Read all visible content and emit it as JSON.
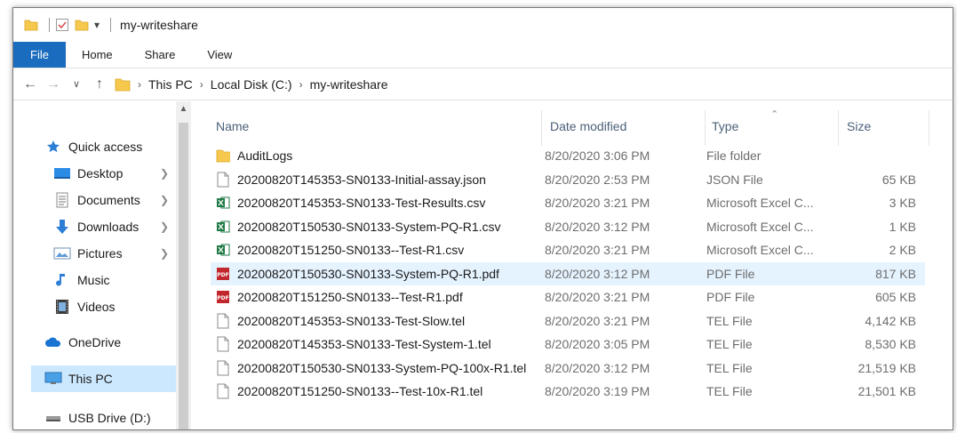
{
  "window": {
    "title": "my-writeshare"
  },
  "ribbon": {
    "tabs": [
      "File",
      "Home",
      "Share",
      "View"
    ]
  },
  "address": {
    "crumbs": [
      "This PC",
      "Local Disk (C:)",
      "my-writeshare"
    ]
  },
  "nav": {
    "items": [
      {
        "label": "Quick access",
        "icon": "star-icon"
      },
      {
        "label": "Desktop",
        "icon": "desktop-icon"
      },
      {
        "label": "Documents",
        "icon": "documents-icon"
      },
      {
        "label": "Downloads",
        "icon": "download-arrow-icon"
      },
      {
        "label": "Pictures",
        "icon": "pictures-icon"
      },
      {
        "label": "Music",
        "icon": "music-note-icon"
      },
      {
        "label": "Videos",
        "icon": "video-film-icon"
      },
      {
        "label": "OneDrive",
        "icon": "cloud-icon"
      },
      {
        "label": "This PC",
        "icon": "monitor-icon"
      },
      {
        "label": "USB Drive (D:)",
        "icon": "usb-drive-icon"
      }
    ]
  },
  "columns": {
    "name": "Name",
    "date": "Date modified",
    "type": "Type",
    "size": "Size"
  },
  "files": [
    {
      "name": "AuditLogs",
      "date": "8/20/2020 3:06 PM",
      "type": "File folder",
      "size": "",
      "icon": "folder-icon"
    },
    {
      "name": "20200820T145353-SN0133-Initial-assay.json",
      "date": "8/20/2020 2:53 PM",
      "type": "JSON File",
      "size": "65 KB",
      "icon": "generic-file-icon"
    },
    {
      "name": "20200820T145353-SN0133-Test-Results.csv",
      "date": "8/20/2020 3:21 PM",
      "type": "Microsoft Excel C...",
      "size": "3 KB",
      "icon": "excel-file-icon"
    },
    {
      "name": "20200820T150530-SN0133-System-PQ-R1.csv",
      "date": "8/20/2020 3:12 PM",
      "type": "Microsoft Excel C...",
      "size": "1 KB",
      "icon": "excel-file-icon"
    },
    {
      "name": "20200820T151250-SN0133--Test-R1.csv",
      "date": "8/20/2020 3:21 PM",
      "type": "Microsoft Excel C...",
      "size": "2 KB",
      "icon": "excel-file-icon"
    },
    {
      "name": "20200820T150530-SN0133-System-PQ-R1.pdf",
      "date": "8/20/2020 3:12 PM",
      "type": "PDF File",
      "size": "817 KB",
      "icon": "pdf-file-icon"
    },
    {
      "name": "20200820T151250-SN0133--Test-R1.pdf",
      "date": "8/20/2020 3:21 PM",
      "type": "PDF File",
      "size": "605 KB",
      "icon": "pdf-file-icon"
    },
    {
      "name": "20200820T145353-SN0133-Test-Slow.tel",
      "date": "8/20/2020 3:21 PM",
      "type": "TEL File",
      "size": "4,142 KB",
      "icon": "generic-file-icon"
    },
    {
      "name": "20200820T145353-SN0133-Test-System-1.tel",
      "date": "8/20/2020 3:05 PM",
      "type": "TEL File",
      "size": "8,530 KB",
      "icon": "generic-file-icon"
    },
    {
      "name": "20200820T150530-SN0133-System-PQ-100x-R1.tel",
      "date": "8/20/2020 3:12 PM",
      "type": "TEL File",
      "size": "21,519 KB",
      "icon": "generic-file-icon"
    },
    {
      "name": "20200820T151250-SN0133--Test-10x-R1.tel",
      "date": "8/20/2020 3:19 PM",
      "type": "TEL File",
      "size": "21,501 KB",
      "icon": "generic-file-icon"
    }
  ],
  "colors": {
    "file_tab": "#1a6cbf",
    "selected_row": "#e5f3ff",
    "selected_nav": "#cce8ff",
    "folder": "#f6c94e"
  }
}
